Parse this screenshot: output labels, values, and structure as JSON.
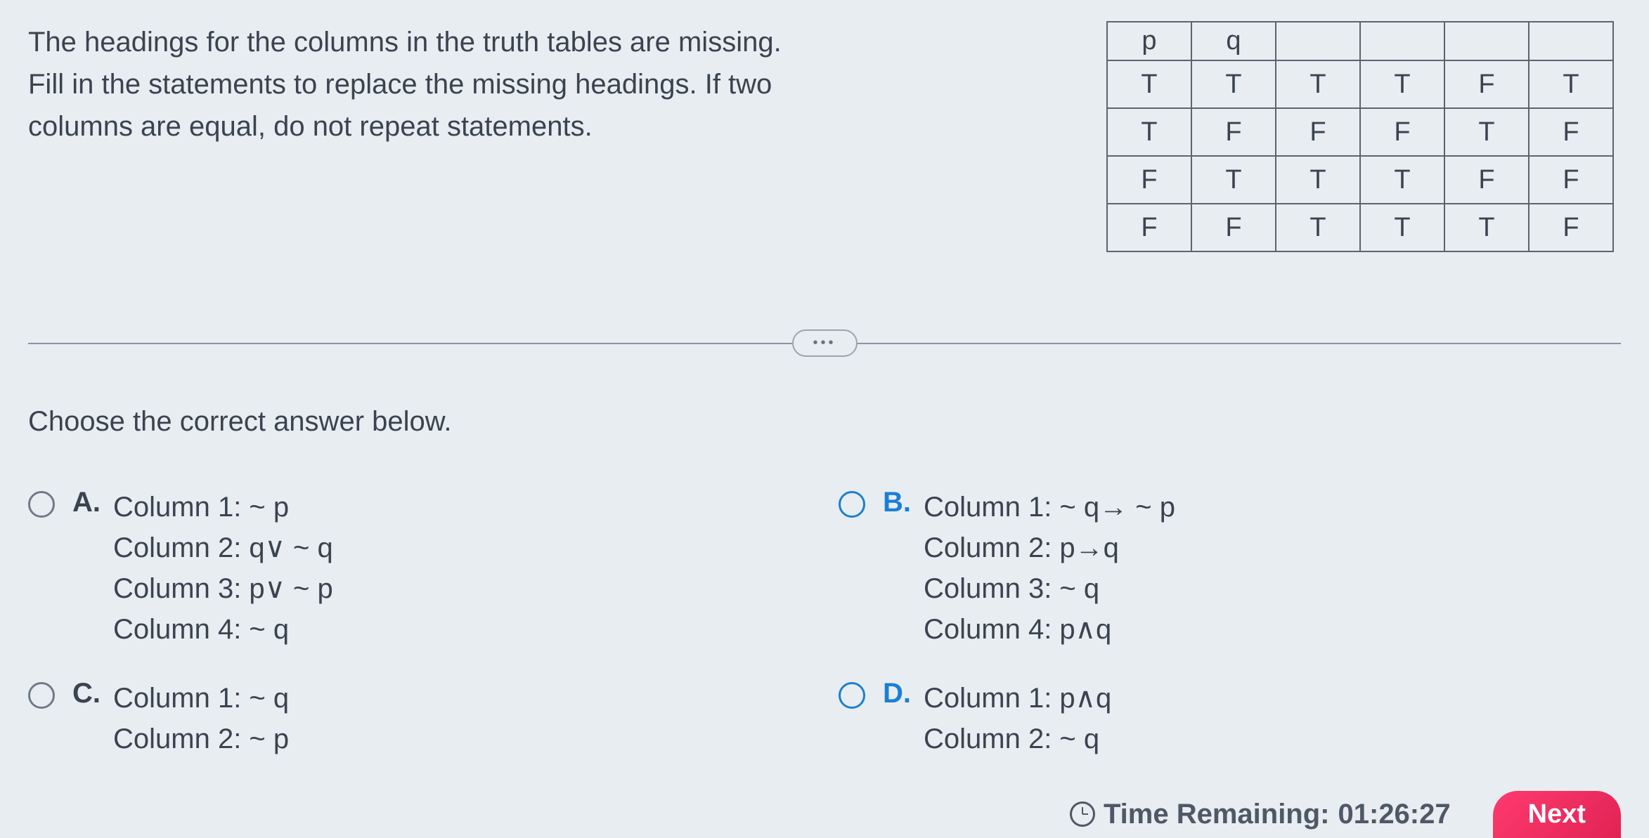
{
  "question": "The headings for the columns in the truth tables are missing. Fill in the statements to replace the missing headings. If two columns are equal, do not repeat statements.",
  "truth_table": {
    "headers": [
      "p",
      "q",
      "",
      "",
      "",
      ""
    ],
    "rows": [
      [
        "T",
        "T",
        "T",
        "T",
        "F",
        "T"
      ],
      [
        "T",
        "F",
        "F",
        "F",
        "T",
        "F"
      ],
      [
        "F",
        "T",
        "T",
        "T",
        "F",
        "F"
      ],
      [
        "F",
        "F",
        "T",
        "T",
        "T",
        "F"
      ]
    ]
  },
  "choose_label": "Choose the correct answer below.",
  "answers": {
    "A": {
      "label": "A.",
      "lines": [
        "Column 1: ~ p",
        "Column 2: q∨ ~ q",
        "Column 3: p∨ ~ p",
        "Column 4: ~ q"
      ]
    },
    "B": {
      "label": "B.",
      "lines": [
        "Column 1: ~ q→ ~ p",
        "Column 2: p→q",
        "Column 3: ~ q",
        "Column 4: p∧q"
      ]
    },
    "C": {
      "label": "C.",
      "lines": [
        "Column 1: ~ q",
        "Column 2: ~ p"
      ]
    },
    "D": {
      "label": "D.",
      "lines": [
        "Column 1: p∧q",
        "Column 2: ~ q"
      ]
    }
  },
  "footer": {
    "time_label": "Time Remaining:",
    "time_value": "01:26:27",
    "next_label": "Next"
  }
}
